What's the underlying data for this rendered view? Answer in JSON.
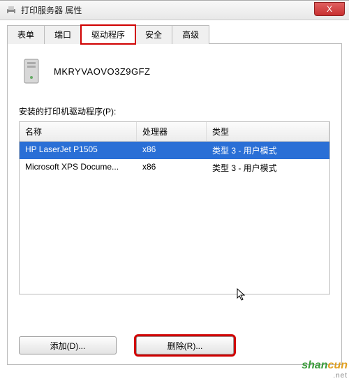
{
  "window": {
    "title": "打印服务器 属性",
    "close_label": "X"
  },
  "tabs": {
    "items": [
      {
        "label": "表单"
      },
      {
        "label": "端口"
      },
      {
        "label": "驱动程序"
      },
      {
        "label": "安全"
      },
      {
        "label": "高级"
      }
    ],
    "active_index": 2
  },
  "server": {
    "name": "MKRYVAOVO3Z9GFZ"
  },
  "drivers": {
    "label": "安装的打印机驱动程序(P):",
    "columns": {
      "name": "名称",
      "processor": "处理器",
      "type": "类型"
    },
    "rows": [
      {
        "name": "HP LaserJet P1505",
        "processor": "x86",
        "type": "类型 3 - 用户模式",
        "selected": true
      },
      {
        "name": "Microsoft XPS Docume...",
        "processor": "x86",
        "type": "类型 3 - 用户模式",
        "selected": false
      }
    ]
  },
  "buttons": {
    "add": "添加(D)...",
    "remove": "删除(R)..."
  },
  "watermark": {
    "text_a": "shan",
    "text_b": "cun",
    "sub": ".net"
  }
}
